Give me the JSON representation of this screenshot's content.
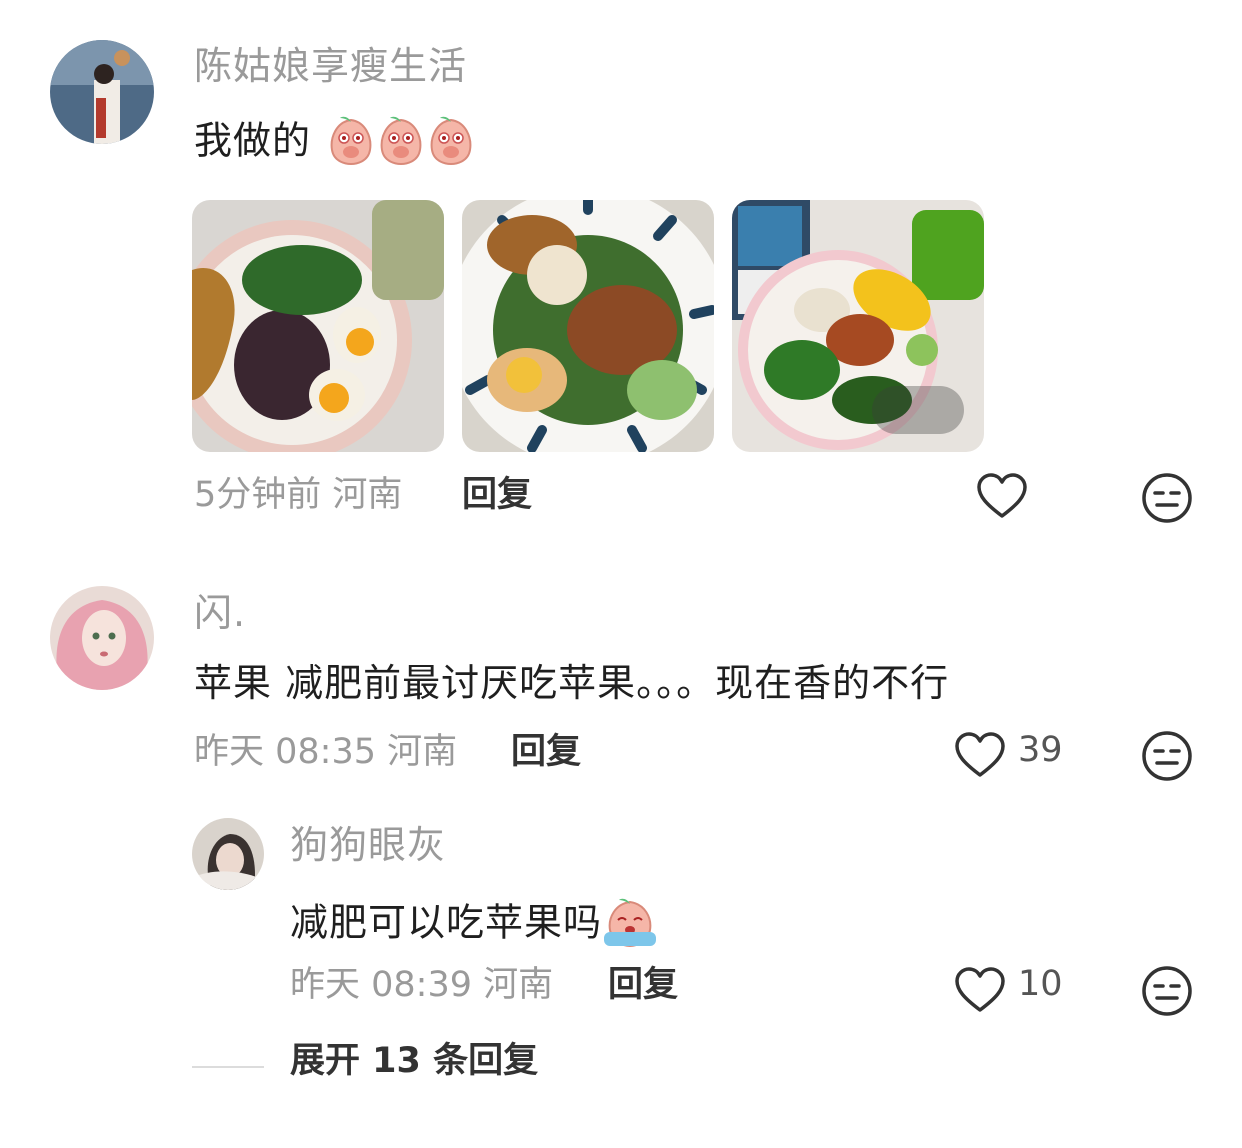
{
  "comments": [
    {
      "username": "陈姑娘享瘦生活",
      "text": "我做的",
      "emoji_count": 3,
      "time": "5分钟前",
      "location": "河南",
      "reply_label": "回复",
      "likes": ""
    },
    {
      "username": "闪.",
      "text": "苹果 减肥前最讨厌吃苹果。。。现在香的不行",
      "time": "昨天 08:35",
      "location": "河南",
      "reply_label": "回复",
      "likes": "39"
    }
  ],
  "sub_reply": {
    "username": "狗狗眼灰",
    "text": "减肥可以吃苹果吗",
    "time": "昨天 08:39",
    "location": "河南",
    "reply_label": "回复",
    "likes": "10"
  },
  "expand_label": "展开 13 条回复",
  "icons": [
    "heart-icon",
    "meh-face-icon",
    "peach-emoji"
  ]
}
